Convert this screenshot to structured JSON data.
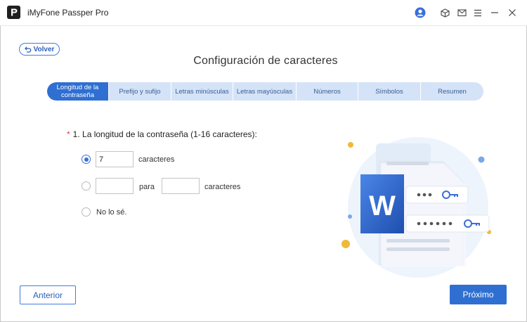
{
  "window": {
    "title": "iMyFone Passper Pro",
    "icons": [
      "account-icon",
      "cube-icon",
      "mail-icon",
      "menu-icon",
      "minimize-icon",
      "close-icon"
    ],
    "accent_color": "#2f6fd1"
  },
  "back": {
    "label": "Volver"
  },
  "page_title": "Configuración  de caracteres",
  "steps": [
    {
      "label": "Longitud de la contraseña",
      "active": true
    },
    {
      "label": "Prefijo y sufijo",
      "active": false
    },
    {
      "label": "Letras minúsculas",
      "active": false
    },
    {
      "label": "Letras mayúsculas",
      "active": false
    },
    {
      "label": "Números",
      "active": false
    },
    {
      "label": "Símbolos",
      "active": false
    },
    {
      "label": "Resumen",
      "active": false
    }
  ],
  "question": {
    "required_mark": "*",
    "text": "1. La longitud de la contraseña (1-16 caracteres):"
  },
  "options": {
    "exact": {
      "selected": true,
      "value": "7",
      "suffix": "caracteres"
    },
    "range": {
      "selected": false,
      "from_value": "",
      "to_value": "",
      "between": "para",
      "suffix": "caracteres"
    },
    "unknown": {
      "selected": false,
      "label": "No lo sé."
    }
  },
  "illustration": {
    "document_letter": "W"
  },
  "footer": {
    "prev_label": "Anterior",
    "next_label": "Próximo"
  }
}
